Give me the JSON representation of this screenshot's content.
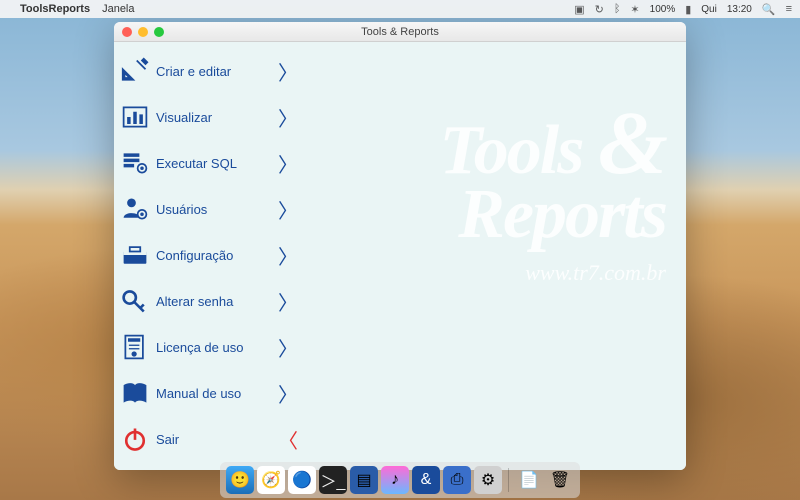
{
  "menubar": {
    "app": "ToolsReports",
    "menus": [
      "Janela"
    ],
    "battery": "100%",
    "day": "Qui",
    "time": "13:20"
  },
  "window": {
    "title": "Tools & Reports"
  },
  "watermark": {
    "line1": "Tools",
    "amp": "&",
    "line2": "Reports",
    "url": "www.tr7.com.br"
  },
  "menu": [
    {
      "id": "criar",
      "label": "Criar e editar",
      "icon": "design-tools-icon"
    },
    {
      "id": "visual",
      "label": "Visualizar",
      "icon": "chart-icon"
    },
    {
      "id": "sql",
      "label": "Executar  SQL",
      "icon": "database-gear-icon"
    },
    {
      "id": "users",
      "label": "Usuários",
      "icon": "user-gear-icon"
    },
    {
      "id": "config",
      "label": "Configuração",
      "icon": "toolbox-icon"
    },
    {
      "id": "pass",
      "label": "Alterar senha",
      "icon": "key-icon"
    },
    {
      "id": "license",
      "label": "Licença de uso",
      "icon": "license-icon"
    },
    {
      "id": "manual",
      "label": "Manual de uso",
      "icon": "book-icon"
    },
    {
      "id": "sair",
      "label": "Sair",
      "icon": "power-icon",
      "exit": true
    }
  ],
  "chevron": "〉"
}
